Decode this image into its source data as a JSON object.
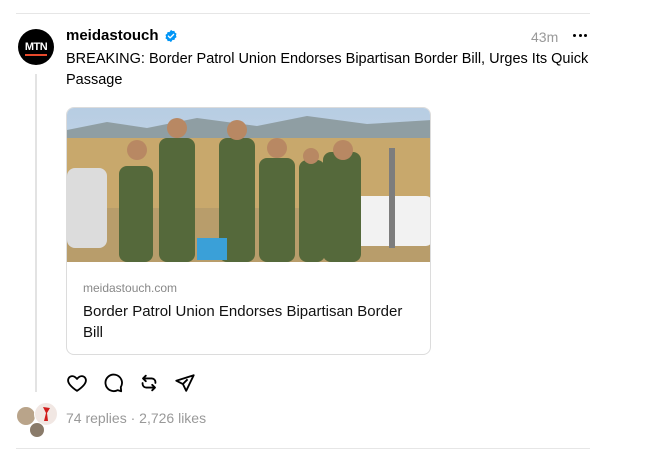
{
  "post": {
    "username": "meidastouch",
    "avatar_text": "MTN",
    "verified_icon": "verified-badge-icon",
    "timestamp": "43m",
    "text": "BREAKING: Border Patrol Union Endorses Bipartisan Border Bill, Urges Its Quick Passage"
  },
  "link_card": {
    "domain": "meidastouch.com",
    "title": "Border Patrol Union Endorses Bipartisan Border Bill",
    "image_icon": "photo-border-patrol-agents"
  },
  "actions": [
    {
      "icon": "heart-icon"
    },
    {
      "icon": "comment-icon"
    },
    {
      "icon": "repost-icon"
    },
    {
      "icon": "share-icon"
    }
  ],
  "stats": {
    "replies": "74 replies",
    "separator": "·",
    "likes": "2,726 likes"
  },
  "colors": {
    "verified": "#0095f6",
    "muted_text": "#999999",
    "divider": "#e6e6e6"
  }
}
